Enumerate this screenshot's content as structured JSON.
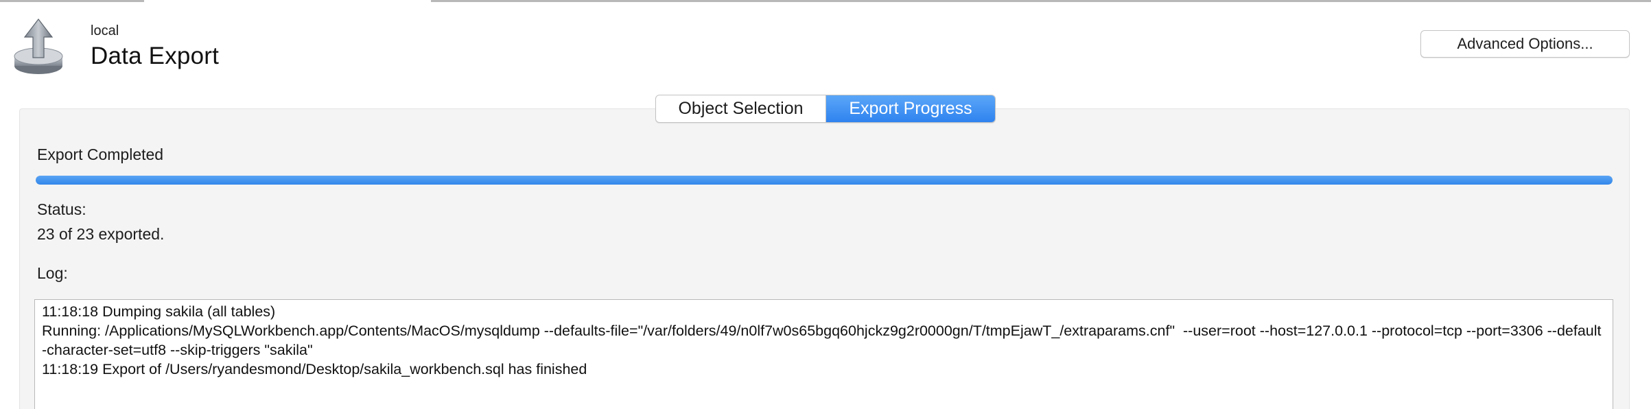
{
  "header": {
    "connection_name": "local",
    "title": "Data Export",
    "advanced_options_label": "Advanced Options..."
  },
  "tabs": [
    {
      "label": "Object Selection",
      "selected": false
    },
    {
      "label": "Export Progress",
      "selected": true
    }
  ],
  "progress": {
    "heading": "Export Completed",
    "percent": 100
  },
  "status": {
    "label": "Status:",
    "value": "23 of 23 exported."
  },
  "log": {
    "label": "Log:",
    "lines": [
      "11:18:18 Dumping sakila (all tables)",
      "Running: /Applications/MySQLWorkbench.app/Contents/MacOS/mysqldump --defaults-file=\"/var/folders/49/n0lf7w0s65bgq60hjckz9g2r0000gn/T/tmpEjawT_/extraparams.cnf\"  --user=root --host=127.0.0.1 --protocol=tcp --port=3306 --default-character-set=utf8 --skip-triggers \"sakila\"",
      "11:18:19 Export of /Users/ryandesmond/Desktop/sakila_workbench.sql has finished"
    ]
  },
  "colors": {
    "accent": "#3287ea",
    "panel_bg": "#f4f4f4"
  },
  "icons": {
    "header": "export-upload-icon"
  }
}
